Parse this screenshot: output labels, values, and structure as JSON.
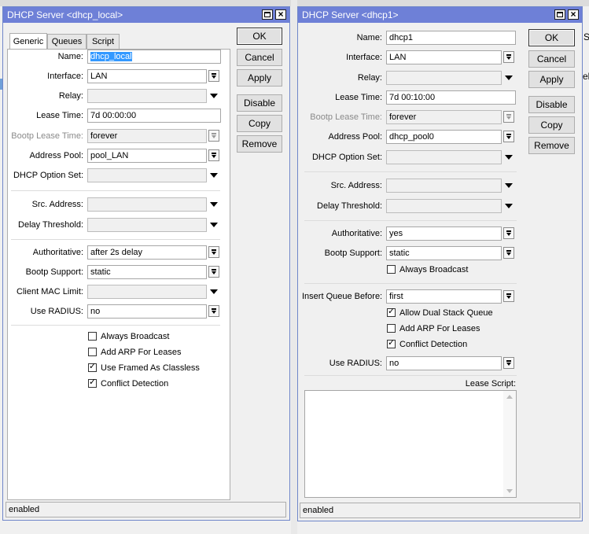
{
  "colors": {
    "title_bar": "#6e80d7",
    "selection": "#3399ff",
    "window_border": "#6f86c9"
  },
  "background": {
    "title_fragment": "S",
    "right_fragment": "ela"
  },
  "window1": {
    "title": "DHCP Server <dhcp_local>",
    "tabs": [
      {
        "label": "Generic",
        "active": true
      },
      {
        "label": "Queues",
        "active": false
      },
      {
        "label": "Script",
        "active": false
      }
    ],
    "fields": {
      "name": {
        "label": "Name:",
        "value": "dhcp_local"
      },
      "interface": {
        "label": "Interface:",
        "value": "LAN"
      },
      "relay": {
        "label": "Relay:",
        "value": ""
      },
      "lease_time": {
        "label": "Lease Time:",
        "value": "7d 00:00:00"
      },
      "bootp_lease_time": {
        "label": "Bootp Lease Time:",
        "value": "forever"
      },
      "address_pool": {
        "label": "Address Pool:",
        "value": "pool_LAN"
      },
      "dhcp_option_set": {
        "label": "DHCP Option Set:",
        "value": ""
      },
      "src_address": {
        "label": "Src. Address:",
        "value": ""
      },
      "delay_threshold": {
        "label": "Delay Threshold:",
        "value": ""
      },
      "authoritative": {
        "label": "Authoritative:",
        "value": "after 2s delay"
      },
      "bootp_support": {
        "label": "Bootp Support:",
        "value": "static"
      },
      "client_mac_limit": {
        "label": "Client MAC Limit:",
        "value": ""
      },
      "use_radius": {
        "label": "Use RADIUS:",
        "value": "no"
      }
    },
    "checkboxes": [
      {
        "label": "Always Broadcast",
        "checked": false
      },
      {
        "label": "Add ARP For Leases",
        "checked": false
      },
      {
        "label": "Use Framed As Classless",
        "checked": true
      },
      {
        "label": "Conflict Detection",
        "checked": true
      }
    ],
    "buttons": {
      "ok": "OK",
      "cancel": "Cancel",
      "apply": "Apply",
      "disable": "Disable",
      "copy": "Copy",
      "remove": "Remove"
    },
    "status": "enabled"
  },
  "window2": {
    "title": "DHCP Server <dhcp1>",
    "fields": {
      "name": {
        "label": "Name:",
        "value": "dhcp1"
      },
      "interface": {
        "label": "Interface:",
        "value": "LAN"
      },
      "relay": {
        "label": "Relay:",
        "value": ""
      },
      "lease_time": {
        "label": "Lease Time:",
        "value": "7d 00:10:00"
      },
      "bootp_lease_time": {
        "label": "Bootp Lease Time:",
        "value": "forever"
      },
      "address_pool": {
        "label": "Address Pool:",
        "value": "dhcp_pool0"
      },
      "dhcp_option_set": {
        "label": "DHCP Option Set:",
        "value": ""
      },
      "src_address": {
        "label": "Src. Address:",
        "value": ""
      },
      "delay_threshold": {
        "label": "Delay Threshold:",
        "value": ""
      },
      "authoritative": {
        "label": "Authoritative:",
        "value": "yes"
      },
      "bootp_support": {
        "label": "Bootp Support:",
        "value": "static"
      },
      "insert_queue_before": {
        "label": "Insert Queue Before:",
        "value": "first"
      },
      "use_radius": {
        "label": "Use RADIUS:",
        "value": "no"
      }
    },
    "always_broadcast": {
      "label": "Always Broadcast",
      "checked": false
    },
    "checkboxes": [
      {
        "label": "Allow Dual Stack Queue",
        "checked": true
      },
      {
        "label": "Add ARP For Leases",
        "checked": false
      },
      {
        "label": "Conflict Detection",
        "checked": true
      }
    ],
    "lease_script_label": "Lease Script:",
    "buttons": {
      "ok": "OK",
      "cancel": "Cancel",
      "apply": "Apply",
      "disable": "Disable",
      "copy": "Copy",
      "remove": "Remove"
    },
    "status": "enabled"
  }
}
